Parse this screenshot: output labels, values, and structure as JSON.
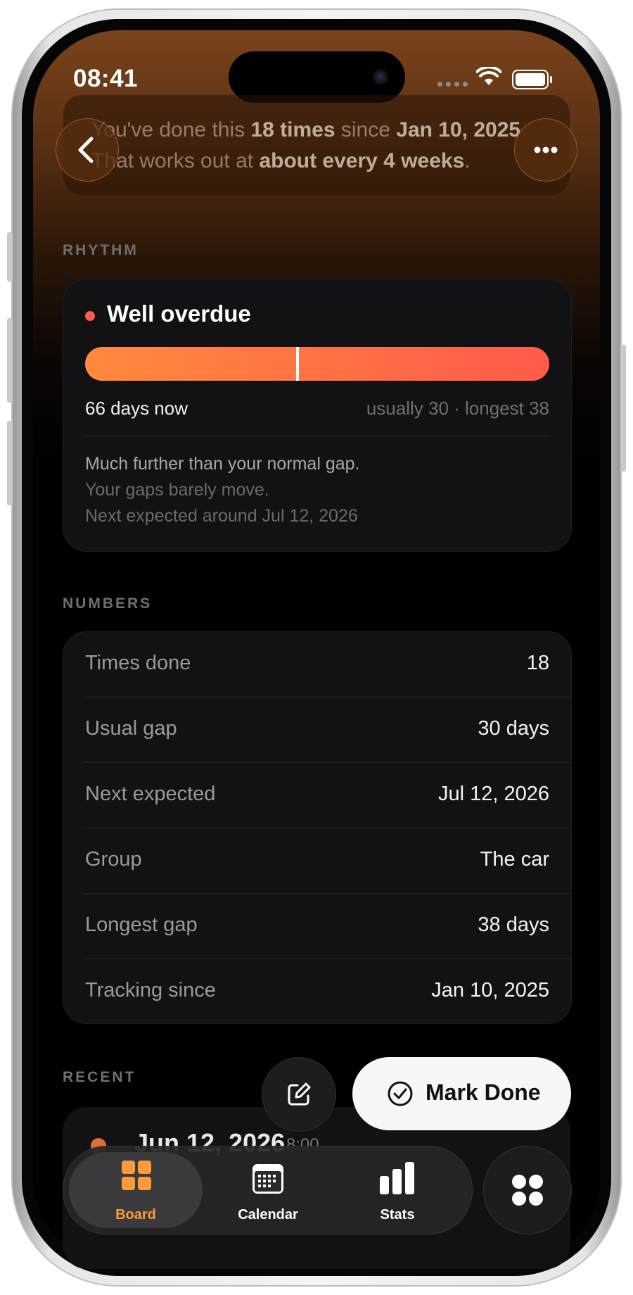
{
  "status_bar": {
    "time": "08:41"
  },
  "banner": {
    "line1_pre": "You've done this ",
    "line1_count": "18 times",
    "line1_mid": " since ",
    "line1_date": "Jan 10, 2025",
    "line2_pre": "That works out at ",
    "line2_freq": "about every 4 weeks",
    "line2_post": "."
  },
  "header": {
    "back_icon": "chevron-left-icon",
    "more_icon": "ellipsis-icon"
  },
  "rhythm": {
    "section_label": "RHYTHM",
    "status": "Well overdue",
    "status_color": "#ff5a4a",
    "progress_fraction": 0.455,
    "current": "66 days now",
    "comparison": "usually 30 · longest 38",
    "note_main": "Much further than your normal gap.",
    "note_sub1": "Your gaps barely move.",
    "note_sub2": "Next expected around Jul 12, 2026"
  },
  "numbers": {
    "section_label": "NUMBERS",
    "rows": [
      {
        "label": "Times done",
        "value": "18"
      },
      {
        "label": "Usual gap",
        "value": "30 days"
      },
      {
        "label": "Next expected",
        "value": "Jul 12, 2026"
      },
      {
        "label": "Group",
        "value": "The car"
      },
      {
        "label": "Longest gap",
        "value": "38 days"
      },
      {
        "label": "Tracking since",
        "value": "Jan 10, 2025"
      }
    ]
  },
  "recent": {
    "section_label": "RECENT",
    "items": [
      {
        "date": "Jun 12, 2026",
        "time": "8:00",
        "dot_color": "#e07030"
      }
    ]
  },
  "actions": {
    "edit_icon": "edit-note-icon",
    "mark_done": "Mark Done",
    "mark_done_icon": "checkmark-circle-icon"
  },
  "tabbar": {
    "tabs": [
      {
        "label": "Board",
        "icon": "board-grid-icon",
        "active": true
      },
      {
        "label": "Calendar",
        "icon": "calendar-icon",
        "active": false
      },
      {
        "label": "Stats",
        "icon": "bar-chart-icon",
        "active": false
      }
    ],
    "extra_icon": "apps-dots-icon",
    "accent": "#ff9a3c"
  }
}
